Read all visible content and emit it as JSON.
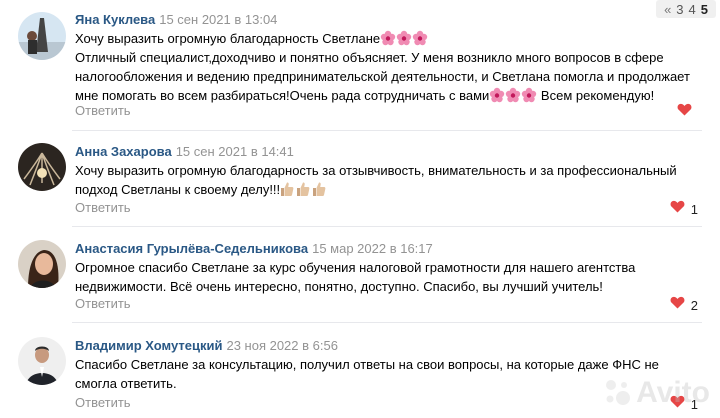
{
  "pager": {
    "prev": "«",
    "pages": [
      "3",
      "4",
      "5"
    ],
    "active": "5"
  },
  "comments": [
    {
      "author": "Яна Куклева",
      "date": "15 сен 2021 в 13:04",
      "line1": "Хочу выразить огромную благодарность Светлане",
      "line2": "Отличный специалист,доходчиво и понятно объясняет. У меня возникло много вопросов в сфере налогообложения и ведению предпринимательской деятельности, и Светлана помогла и продолжает мне помогать во всем разбираться!Очень рада сотрудничать с вами",
      "line3": " Всем рекомендую!",
      "reply": "Ответить",
      "likes": ""
    },
    {
      "author": "Анна Захарова",
      "date": "15 сен 2021 в 14:41",
      "text": "Хочу выразить огромную благодарность за отзывчивость, внимательность и за профессиональный подход Светланы к своему делу!!!",
      "reply": "Ответить",
      "likes": "1"
    },
    {
      "author": "Анастасия Гурылёва-Седельникова",
      "date": "15 мар 2022 в 16:17",
      "text": "Огромное спасибо Светлане за курс обучения налоговой грамотности для нашего агентства недвижимости. Всё очень интересно, понятно, доступно. Спасибо, вы лучший учитель!",
      "reply": "Ответить",
      "likes": "2"
    },
    {
      "author": "Владимир Хомутецкий",
      "date": "23 ноя 2022 в 6:56",
      "text": "Спасибо Светлане за консультацию, получил ответы на свои вопросы, на которые даже ФНС не смогла ответить.",
      "reply": "Ответить",
      "likes": "1"
    }
  ],
  "watermark": "Avito",
  "colors": {
    "author": "#2a5885",
    "muted": "#939393",
    "heart": "#e64646",
    "separator": "#e7e8ec"
  }
}
